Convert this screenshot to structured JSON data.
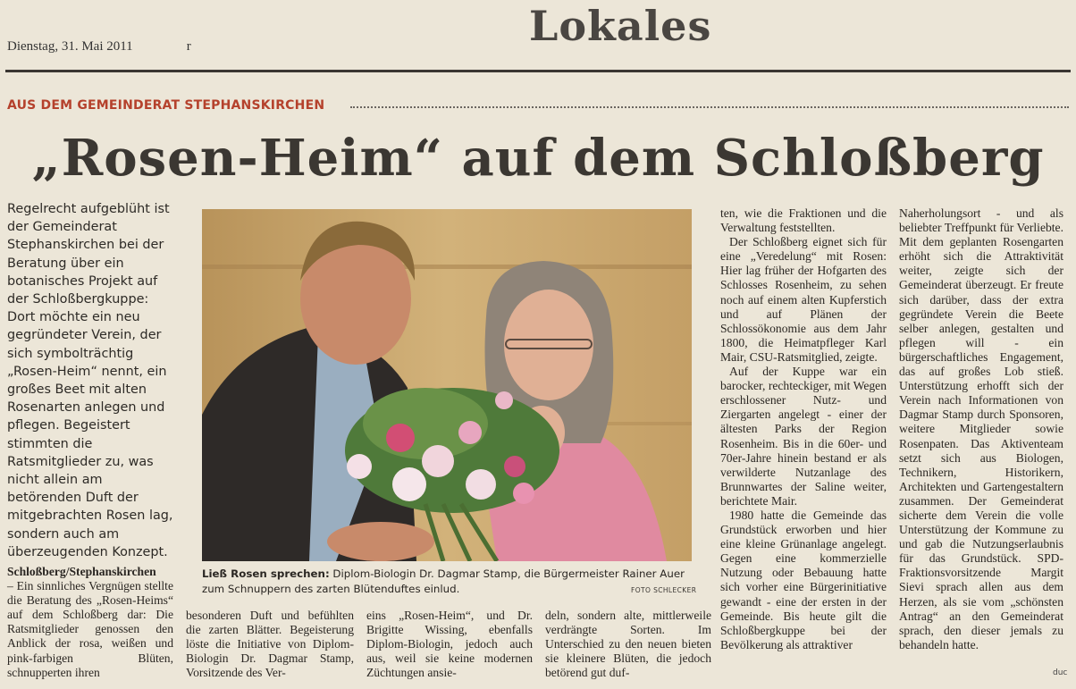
{
  "masthead": {
    "date": "Dienstag, 31. Mai 2011",
    "mark": "r",
    "section": "Lokales"
  },
  "article": {
    "kicker": "AUS DEM GEMEINDERAT STEPHANSKIRCHEN",
    "headline": "„Rosen-Heim“ auf dem Schloßberg",
    "intro": "Regelrecht aufgeblüht ist der Gemeinderat Stephanskirchen bei der Beratung über ein botanisches Projekt auf der Schloßbergkuppe: Dort möchte ein neu gegründeter Verein, der sich symbolträchtig „Rosen-Heim“ nennt, ein großes Beet mit alten Rosenarten anlegen und pflegen. Begeistert stimmten die Ratsmitglieder zu, was nicht allein am betörenden Duft der mitgebrachten Rosen lag, sondern auch am überzeugenden Konzept.",
    "dateline": "Schloßberg/Stephanskirchen",
    "col1": "– Ein sinnliches Vergnügen stellte die Beratung des „Rosen-Heims“ auf dem Schloßberg dar: Die Ratsmitglieder genossen den Anblick der rosa, weißen und pink-farbigen Blüten, schnupperten ihren",
    "col2": "besonderen Duft und befühlten die zarten Blätter. Begeisterung löste die Initiative von Diplom-Biologin Dr. Dagmar Stamp, Vorsitzende des Ver-",
    "col3": "eins „Rosen-Heim“, und Dr. Brigitte Wissing, ebenfalls Diplom-Biologin, jedoch auch aus, weil sie keine modernen Züchtungen ansie-",
    "col4": "deln, sondern alte, mittlerweile verdrängte Sorten. Im Unterschied zu den neuen bieten sie kleinere Blüten, die jedoch betörend gut duf-",
    "col5": [
      "ten, wie die Fraktionen und die Verwaltung feststellten.",
      "Der Schloßberg eignet sich für eine „Veredelung“ mit Rosen: Hier lag früher der Hofgarten des Schlosses Rosenheim, zu sehen noch auf einem alten Kupferstich und auf Plänen der Schlossökonomie aus dem Jahr 1800, die Heimatpfleger Karl Mair, CSU-Ratsmitglied, zeigte.",
      "Auf der Kuppe war ein barocker, rechteckiger, mit Wegen erschlossener Nutz- und Ziergarten angelegt - einer der ältesten Parks der Region Rosenheim. Bis in die 60er- und 70er-Jahre hinein bestand er als verwilderte Nutzanlage des Brunnwartes der Saline weiter, berichtete Mair.",
      "1980 hatte die Gemeinde das Grundstück erworben und hier eine kleine Grünanlage angelegt. Gegen eine kommerzielle Nutzung oder Bebauung hatte sich vorher eine Bürgerinitiative gewandt - eine der ersten in der Gemeinde. Bis heute gilt die Schloßbergkuppe bei der Bevölkerung als attraktiver"
    ],
    "col6": "Naherholungsort - und als beliebter Treffpunkt für Verliebte. Mit dem geplanten Rosengarten erhöht sich die Attraktivität weiter, zeigte sich der Gemeinderat überzeugt. Er freute sich darüber, dass der extra gegründete Verein die Beete selber anlegen, gestalten und pflegen will - ein bürgerschaftliches Engagement, das auf großes Lob stieß. Unterstützung erhofft sich der Verein nach Informationen von Dagmar Stamp durch Sponsoren, weitere Mitglieder sowie Rosenpaten. Das Aktiventeam setzt sich aus Biologen, Technikern, Historikern, Architekten und Gartengestaltern zusammen. Der Gemeinderat sicherte dem Verein die volle Unterstützung der Kommune zu und gab die Nutzungserlaubnis für das Grundstück. SPD-Fraktionsvorsitzende Margit Sievi sprach allen aus dem Herzen, als sie vom „schönsten Antrag“ an den Gemeinderat sprach, den dieser jemals zu behandeln hatte.",
    "signature": "duc"
  },
  "photo": {
    "caption_lead": "Ließ Rosen sprechen:",
    "caption_text": " Diplom-Biologin Dr. Dagmar Stamp, die Bürgermeister Rainer Auer zum Schnuppern des zarten Blütenduftes einlud.",
    "credit": "FOTO SCHLECKER"
  },
  "colors": {
    "paper": "#ece6d8",
    "kicker": "#b5412c",
    "text": "#2a2622"
  }
}
